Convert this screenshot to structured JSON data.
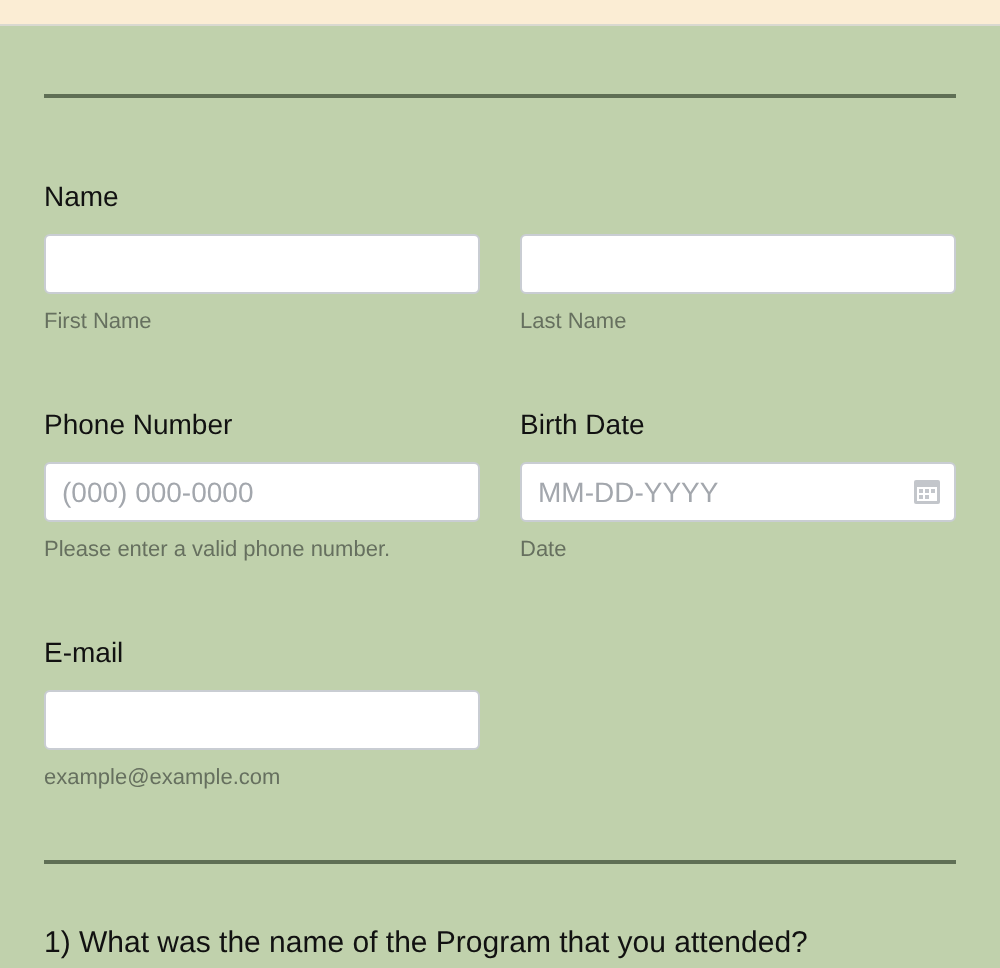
{
  "fields": [
    {
      "label": "Name",
      "inputs": [
        {
          "kind": "text",
          "sublabel": "First Name"
        },
        {
          "kind": "text",
          "sublabel": "Last Name"
        }
      ]
    },
    {
      "label": "Phone Number",
      "inputs": [
        {
          "kind": "text",
          "placeholder": "(000) 000-0000",
          "sublabel": "Please enter a valid phone number."
        }
      ]
    },
    {
      "label": "Birth Date",
      "inputs": [
        {
          "kind": "date",
          "placeholder": "MM-DD-YYYY",
          "sublabel": "Date"
        }
      ]
    },
    {
      "label": "E-mail",
      "inputs": [
        {
          "kind": "text",
          "sublabel": "example@example.com"
        }
      ]
    }
  ],
  "question": "1) What was the name of the Program that you attended?"
}
